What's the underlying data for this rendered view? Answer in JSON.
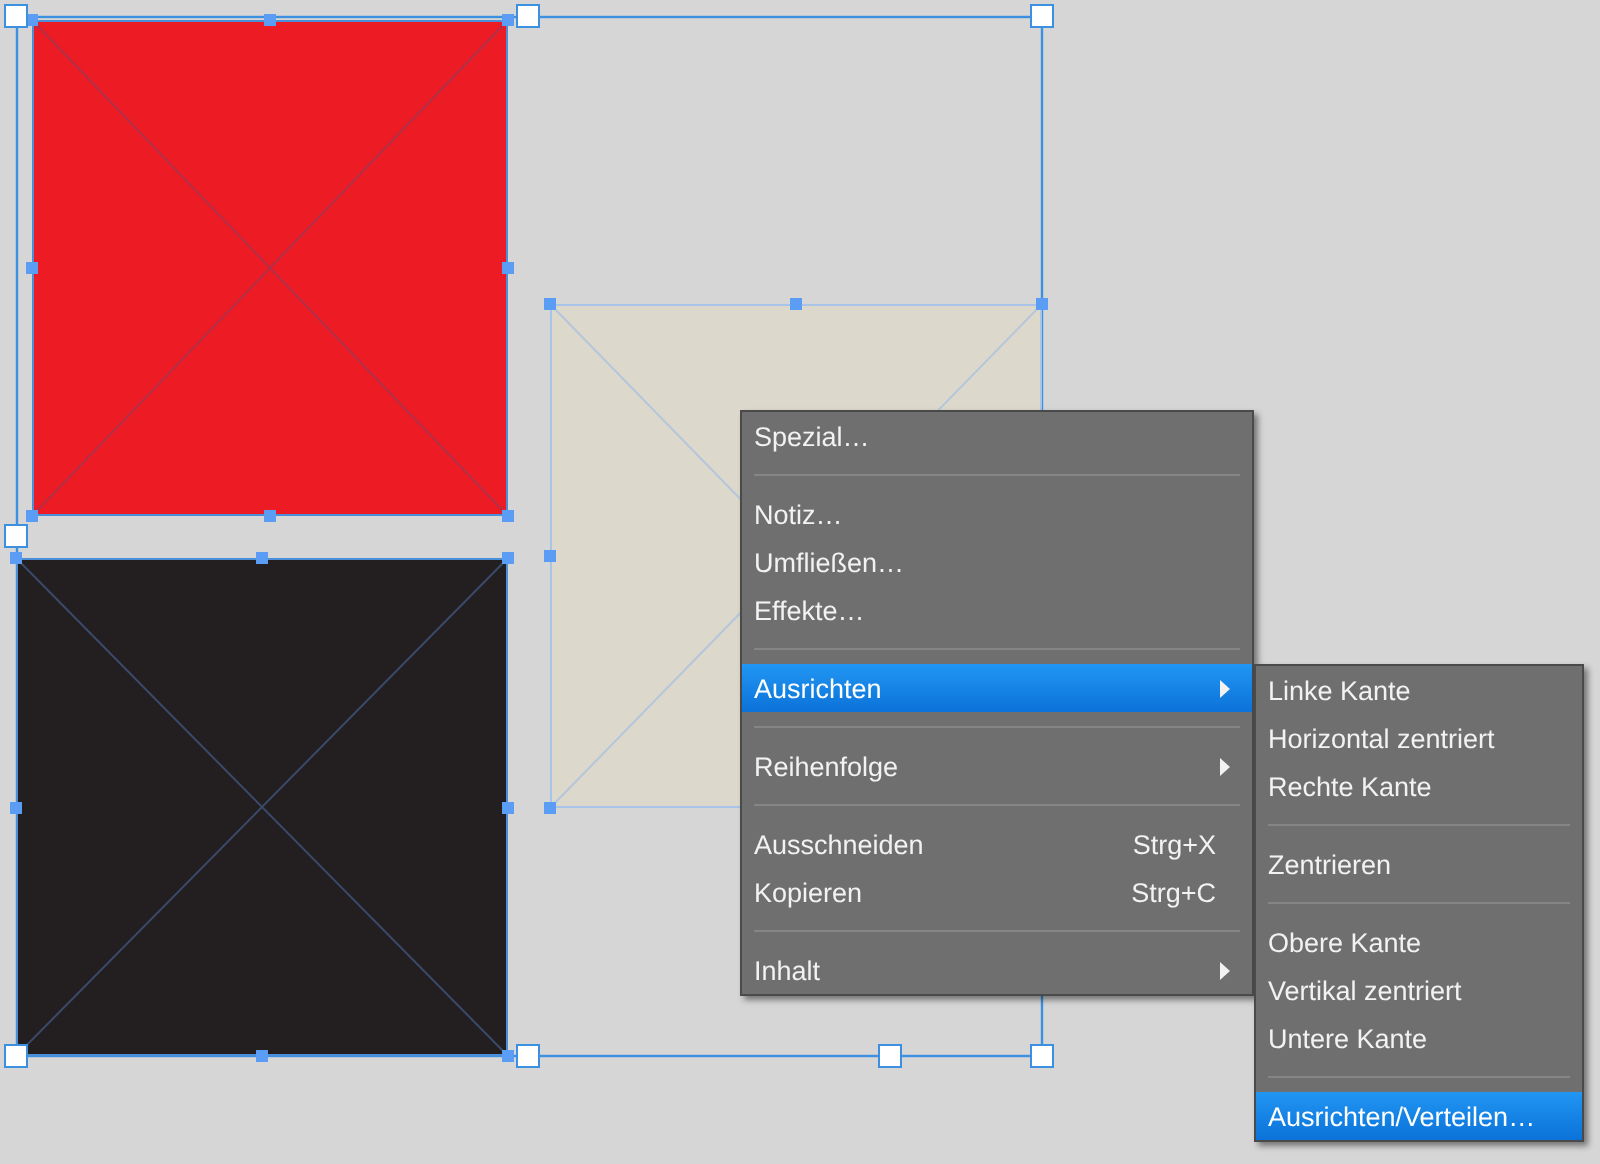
{
  "frames": [
    {
      "color": "#ed1c24"
    },
    {
      "color": "#231f20"
    },
    {
      "color": "#dcd8cc"
    }
  ],
  "context_menu": {
    "items": [
      {
        "kind": "item",
        "label": "Spezial…",
        "selected": false,
        "has_submenu": false
      },
      {
        "kind": "separator"
      },
      {
        "kind": "item",
        "label": "Notiz…",
        "selected": false,
        "has_submenu": false
      },
      {
        "kind": "item",
        "label": "Umfließen…",
        "selected": false,
        "has_submenu": false
      },
      {
        "kind": "item",
        "label": "Effekte…",
        "selected": false,
        "has_submenu": false
      },
      {
        "kind": "separator"
      },
      {
        "kind": "item",
        "label": "Ausrichten",
        "selected": true,
        "has_submenu": true
      },
      {
        "kind": "separator"
      },
      {
        "kind": "item",
        "label": "Reihenfolge",
        "selected": false,
        "has_submenu": true
      },
      {
        "kind": "separator"
      },
      {
        "kind": "item",
        "label": "Ausschneiden",
        "shortcut": "Strg+X",
        "selected": false,
        "has_submenu": false
      },
      {
        "kind": "item",
        "label": "Kopieren",
        "shortcut": "Strg+C",
        "selected": false,
        "has_submenu": false
      },
      {
        "kind": "separator"
      },
      {
        "kind": "item",
        "label": "Inhalt",
        "selected": false,
        "has_submenu": true
      }
    ]
  },
  "submenu": {
    "items": [
      {
        "kind": "item",
        "label": "Linke Kante",
        "selected": false
      },
      {
        "kind": "item",
        "label": "Horizontal zentriert",
        "selected": false
      },
      {
        "kind": "item",
        "label": "Rechte Kante",
        "selected": false
      },
      {
        "kind": "separator"
      },
      {
        "kind": "item",
        "label": "Zentrieren",
        "selected": false
      },
      {
        "kind": "separator"
      },
      {
        "kind": "item",
        "label": "Obere Kante",
        "selected": false
      },
      {
        "kind": "item",
        "label": "Vertikal zentriert",
        "selected": false
      },
      {
        "kind": "item",
        "label": "Untere Kante",
        "selected": false
      },
      {
        "kind": "separator"
      },
      {
        "kind": "item",
        "label": "Ausrichten/Verteilen…",
        "selected": true
      }
    ]
  }
}
